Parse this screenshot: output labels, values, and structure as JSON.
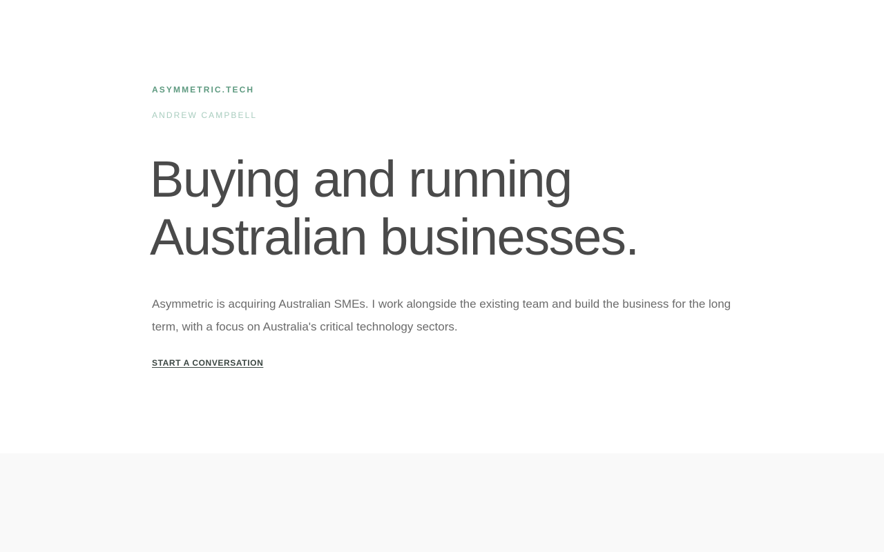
{
  "hero": {
    "brand": "ASYMMETRIC.TECH",
    "author": "ANDREW CAMPBELL",
    "headline_line1": "Buying and running",
    "headline_line2": "Australian businesses.",
    "description": "Asymmetric is acquiring Australian SMEs. I work alongside the existing team and build the business for the long term, with a focus on Australia's critical technology sectors.",
    "cta_label": "START A CONVERSATION"
  },
  "colors": {
    "brand": "#5e9a80",
    "author": "#a9cdbf",
    "headline": "#4a4a4a",
    "body_text": "#6b6b6b",
    "cta": "#3b4642",
    "page_background": "#ffffff",
    "footer_background": "#f9f9f9"
  }
}
